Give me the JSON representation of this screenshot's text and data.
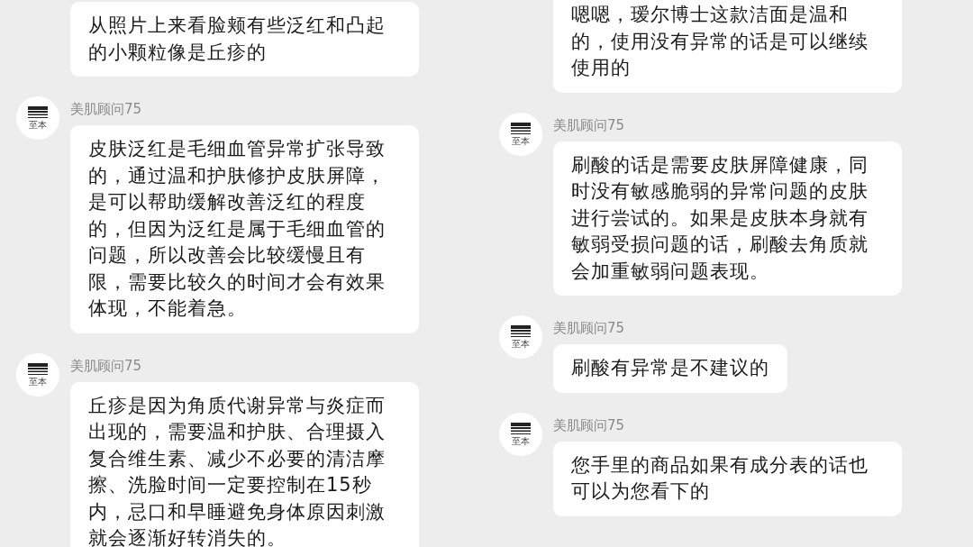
{
  "panels": [
    {
      "messages": [
        {
          "text": "从照片上来看脸颊有些泛红和凸起的小颗粒像是丘疹的"
        },
        {
          "sender": "美肌顾问75",
          "avatar_text": "至本",
          "text": "皮肤泛红是毛细血管异常扩张导致的，通过温和护肤修护皮肤屏障，是可以帮助缓解改善泛红的程度的，但因为泛红是属于毛细血管的问题，所以改善会比较缓慢且有限，需要比较久的时间才会有效果体现，不能着急。"
        },
        {
          "sender": "美肌顾问75",
          "avatar_text": "至本",
          "text": "丘疹是因为角质代谢异常与炎症而出现的，需要温和护肤、合理摄入复合维生素、减少不必要的清洁摩擦、洗脸时间一定要控制在15秒内，忌口和早睡避免身体原因刺激就会逐渐好转消失的。"
        }
      ]
    },
    {
      "messages": [
        {
          "text": "嗯嗯，瑷尔博士这款洁面是温和的，使用没有异常的话是可以继续使用的"
        },
        {
          "sender": "美肌顾问75",
          "avatar_text": "至本",
          "text": "刷酸的话是需要皮肤屏障健康，同时没有敏感脆弱的异常问题的皮肤进行尝试的。如果是皮肤本身就有敏弱受损问题的话，刷酸去角质就会加重敏弱问题表现。"
        },
        {
          "sender": "美肌顾问75",
          "avatar_text": "至本",
          "text": "刷酸有异常是不建议的"
        },
        {
          "sender": "美肌顾问75",
          "avatar_text": "至本",
          "text": "您手里的商品如果有成分表的话也可以为您看下的"
        }
      ]
    }
  ]
}
